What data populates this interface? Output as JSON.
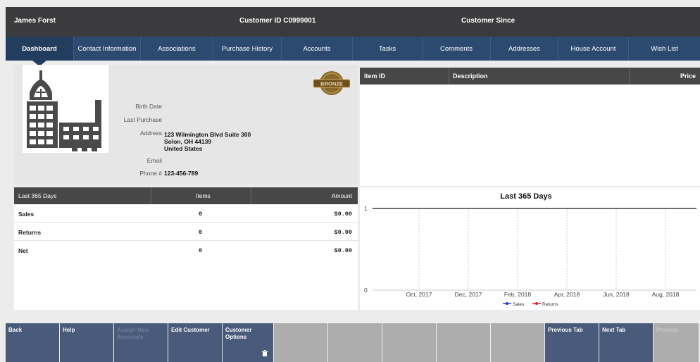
{
  "header": {
    "customer_name": "James Forst",
    "customer_id": "Customer ID  C0999001",
    "customer_since": "Customer Since"
  },
  "tabs": [
    {
      "label": "Dashboard",
      "active": true
    },
    {
      "label": "Contact Information"
    },
    {
      "label": "Associations"
    },
    {
      "label": "Purchase History"
    },
    {
      "label": "Accounts"
    },
    {
      "label": "Tasks"
    },
    {
      "label": "Comments"
    },
    {
      "label": "Addresses"
    },
    {
      "label": "House Account"
    },
    {
      "label": "Wish List"
    }
  ],
  "profile": {
    "badge": "BRONZE",
    "birth_date_label": "Birth Date",
    "last_purchase_label": "Last Purchase",
    "address_label": "Address",
    "address_line1": "123 Wilmington Blvd Suite 300",
    "address_line2": "Solon, OH 44139",
    "address_line3": "United States",
    "email_label": "Email",
    "phone_label": "Phone #",
    "phone_value": "123-456-789"
  },
  "items_table": {
    "columns": [
      "Item ID",
      "Description",
      "Price"
    ]
  },
  "summary": {
    "columns": [
      "Last 365 Days",
      "Items",
      "Amount"
    ],
    "rows": [
      {
        "label": "Sales",
        "items": "0",
        "amount": "$0.00"
      },
      {
        "label": "Returns",
        "items": "0",
        "amount": "$0.00"
      },
      {
        "label": "Net",
        "items": "0",
        "amount": "$0.00"
      }
    ]
  },
  "chart_data": {
    "type": "line",
    "title": "Last 365 Days",
    "x": [
      "Oct, 2017",
      "Dec, 2017",
      "Feb, 2018",
      "Apr, 2018",
      "Jun, 2018",
      "Aug, 2018"
    ],
    "y_ticks": [
      "0",
      "1"
    ],
    "ylim": [
      0,
      1
    ],
    "series": [
      {
        "name": "Sales",
        "color": "#1f3fd0",
        "values": [
          1,
          1,
          1,
          1,
          1,
          1
        ]
      },
      {
        "name": "Returns",
        "color": "#e02020",
        "values": [
          1,
          1,
          1,
          1,
          1,
          1
        ]
      }
    ],
    "grid": "vertical dashed",
    "legend": "bottom"
  },
  "buttons": [
    {
      "label": "Back",
      "style": "blue"
    },
    {
      "label": "Help",
      "style": "blue"
    },
    {
      "label": "Assign New Associate",
      "style": "disabled-blue"
    },
    {
      "label": "Edit Customer",
      "style": "blue"
    },
    {
      "label": "Customer Options",
      "style": "blue",
      "icon": "trash-icon"
    },
    {
      "label": "",
      "style": "grey"
    },
    {
      "label": "",
      "style": "grey"
    },
    {
      "label": "",
      "style": "grey"
    },
    {
      "label": "",
      "style": "grey"
    },
    {
      "label": "",
      "style": "grey"
    },
    {
      "label": "Previous Tab",
      "style": "blue"
    },
    {
      "label": "Next Tab",
      "style": "blue"
    },
    {
      "label": "Process",
      "style": "grey"
    }
  ]
}
